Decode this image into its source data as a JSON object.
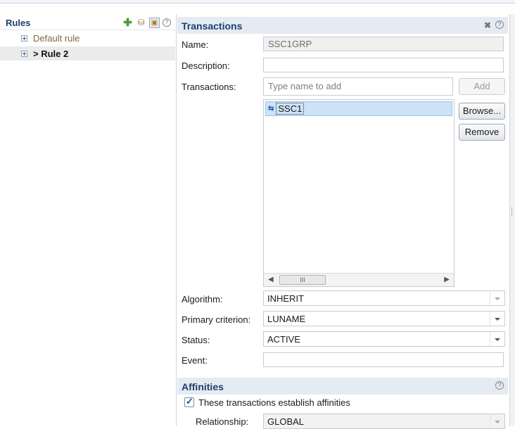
{
  "rules": {
    "title": "Rules",
    "toolbar": {
      "add_icon": "plus-icon",
      "folder_icon": "folder-icon",
      "select_icon": "selection-icon",
      "help_icon": "help-icon",
      "help_glyph": "?"
    },
    "items": [
      {
        "label": "Default rule",
        "selected": false
      },
      {
        "label": "> Rule 2",
        "selected": true
      }
    ]
  },
  "transactions": {
    "title": "Transactions",
    "close_glyph": "✖",
    "help_glyph": "?",
    "name_label": "Name:",
    "name_value": "SSC1GRP",
    "description_label": "Description:",
    "description_value": "",
    "transactions_label": "Transactions:",
    "transactions_placeholder": "Type name to add",
    "add_button": "Add",
    "browse_button": "Browse...",
    "remove_button": "Remove",
    "list": [
      {
        "icon_glyph": "⇆",
        "label": "SSC1"
      }
    ],
    "scroll_thumb": "III",
    "scroll_left": "◀",
    "scroll_right": "▶",
    "algorithm_label": "Algorithm:",
    "algorithm_value": "INHERIT",
    "primary_label": "Primary criterion:",
    "primary_value": "LUNAME",
    "status_label": "Status:",
    "status_value": "ACTIVE",
    "event_label": "Event:",
    "event_value": ""
  },
  "affinities": {
    "title": "Affinities",
    "help_glyph": "?",
    "checkbox_label": "These transactions establish affinities",
    "checked": true,
    "relationship_label": "Relationship:",
    "relationship_value": "GLOBAL"
  },
  "colors": {
    "section_title": "#1d3f6b",
    "section_bg": "#e5ebf3",
    "selection_bg": "#cde3f8",
    "accent_green": "#4f9a2a"
  }
}
